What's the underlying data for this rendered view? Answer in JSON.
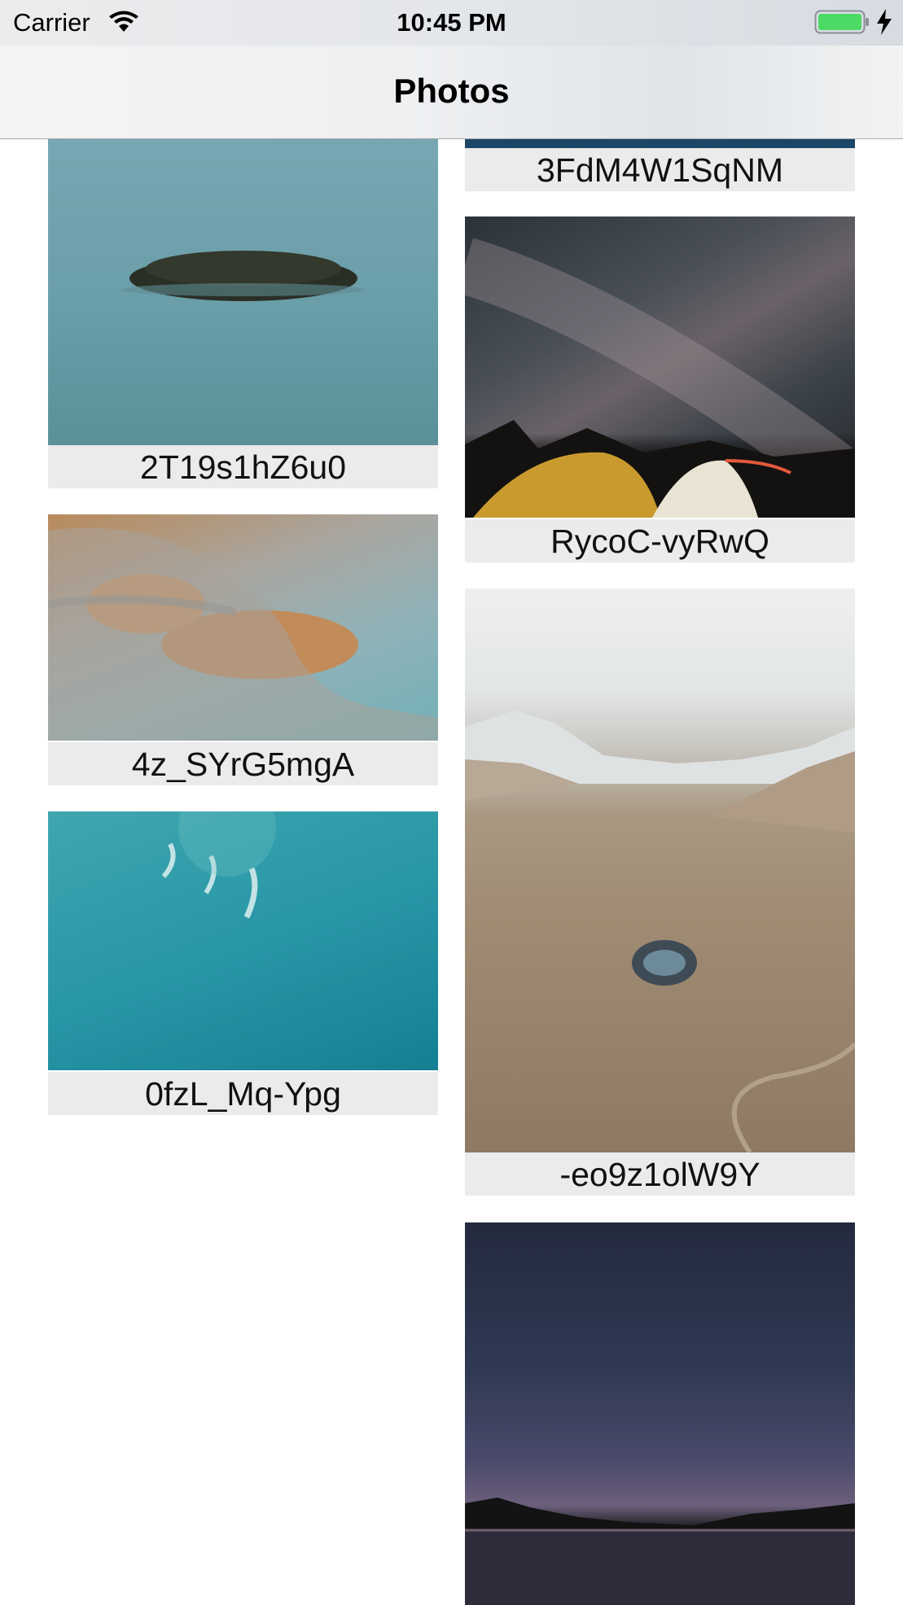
{
  "status_bar": {
    "carrier": "Carrier",
    "time": "10:45 PM",
    "wifi_icon": "wifi-icon",
    "battery_icon": "battery-icon",
    "charging_icon": "bolt-icon",
    "battery_color": "#4cd964"
  },
  "nav": {
    "title": "Photos"
  },
  "photos": {
    "left": [
      {
        "id": "2T19s1hZ6u0"
      },
      {
        "id": "4z_SYrG5mgA"
      },
      {
        "id": "0fzL_Mq-Ypg"
      }
    ],
    "right": [
      {
        "id": "3FdM4W1SqNM"
      },
      {
        "id": "RycoC-vyRwQ"
      },
      {
        "id": "-eo9z1olW9Y"
      }
    ]
  },
  "colors": {
    "caption_background": "#ebebeb",
    "nav_background": "#f4f4f5"
  }
}
